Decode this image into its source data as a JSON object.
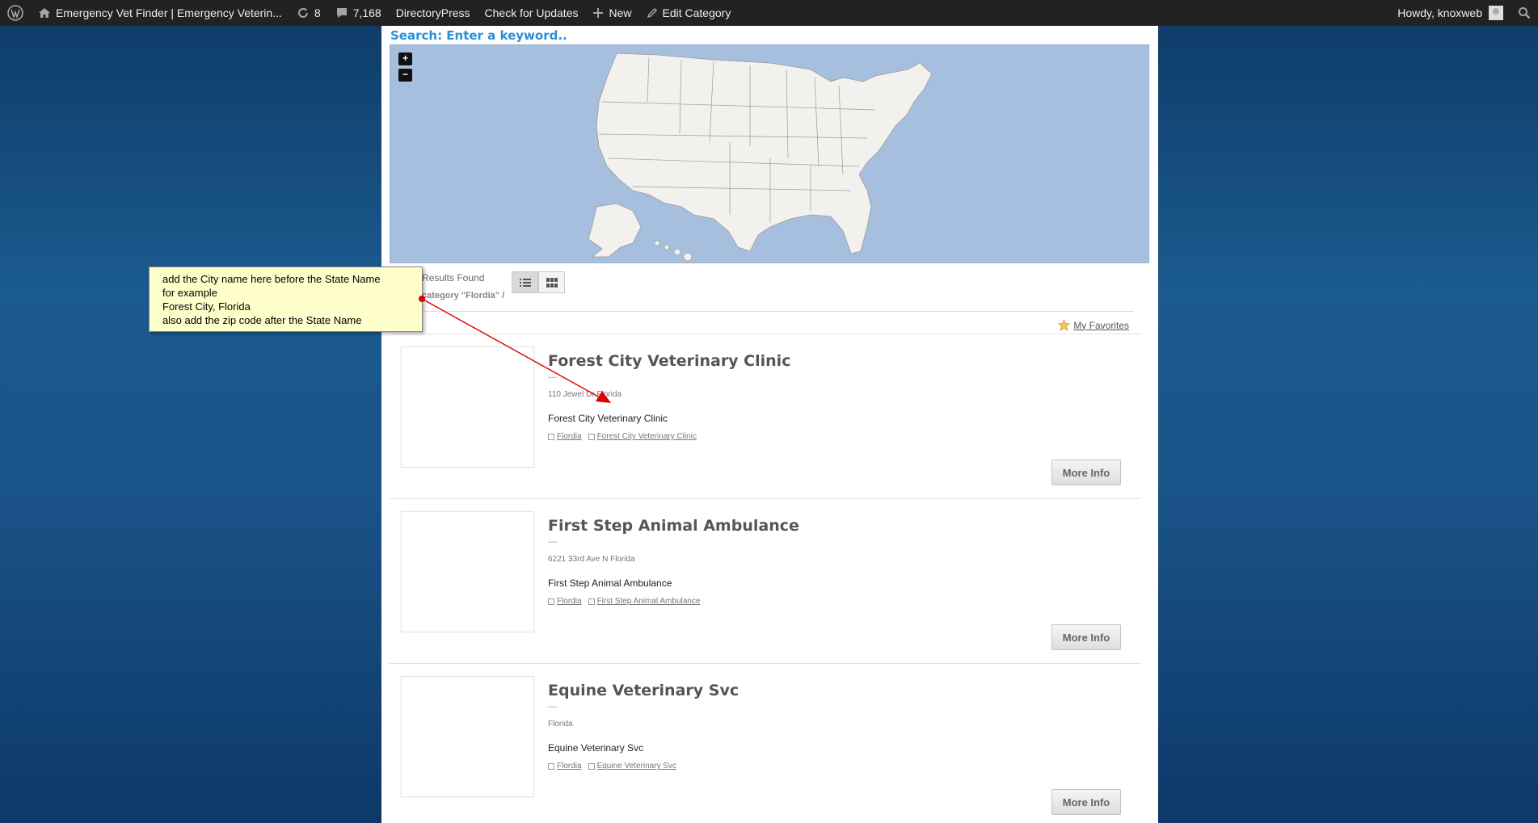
{
  "adminbar": {
    "site_title": "Emergency Vet Finder | Emergency Veterin...",
    "updates_count": "8",
    "comments_count": "7,168",
    "directorypress": "DirectoryPress",
    "check_updates": "Check for Updates",
    "new_label": "New",
    "edit_category": "Edit Category",
    "howdy": "Howdy, knoxweb"
  },
  "search": {
    "prompt": "Search: Enter a keyword.."
  },
  "map": {
    "zoom_in": "+",
    "zoom_out": "−"
  },
  "results": {
    "found_label": "Results Found",
    "category_label": "category \"Flordia\" /"
  },
  "favorites_label": "My Favorites",
  "listings": [
    {
      "title": "Forest City Veterinary Clinic",
      "dash": "—",
      "address": "110 Jewel Dr Florida",
      "name": "Forest City Veterinary Clinic",
      "tag1": "Flordia",
      "tag2": "Forest City Veterinary Clinic",
      "button": "More Info"
    },
    {
      "title": "First Step Animal Ambulance",
      "dash": "—",
      "address": "6221 33rd Ave N Florida",
      "name": "First Step Animal Ambulance",
      "tag1": "Flordia",
      "tag2": "First Step Animal Ambulance",
      "button": "More Info"
    },
    {
      "title": "Equine Veterinary Svc",
      "dash": "—",
      "address": "Florida",
      "name": "Equine Veterinary Svc",
      "tag1": "Flordia",
      "tag2": "Equine Veterinary Svc",
      "button": "More Info"
    }
  ],
  "annotation": {
    "line1": "add the City name here before the State Name",
    "line2": "for example",
    "line3": "Forest City, Florida",
    "line4": "also add the zip code after the State Name"
  },
  "colors": {
    "adminbar_bg": "#222222",
    "search_blue": "#2a8fd6",
    "map_water": "#a7bfde",
    "note_bg": "#ffffcc",
    "arrow_red": "#dd0000"
  }
}
